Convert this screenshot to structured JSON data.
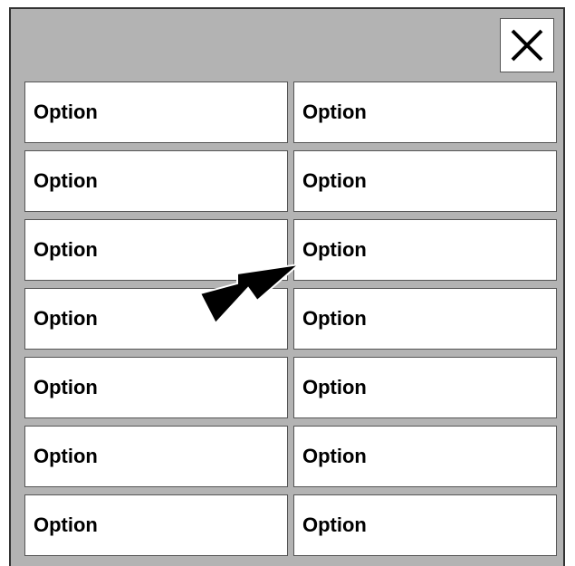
{
  "dialog": {
    "close_icon": "close-icon",
    "options": [
      "Option",
      "Option",
      "Option",
      "Option",
      "Option",
      "Option",
      "Option",
      "Option",
      "Option",
      "Option",
      "Option",
      "Option",
      "Option",
      "Option"
    ]
  },
  "overlay": {
    "pointer_icon": "arrow-pointer-icon",
    "colors": {
      "arrow": "#000000",
      "panel": "#b3b3b3",
      "option_bg": "#ffffff"
    }
  }
}
